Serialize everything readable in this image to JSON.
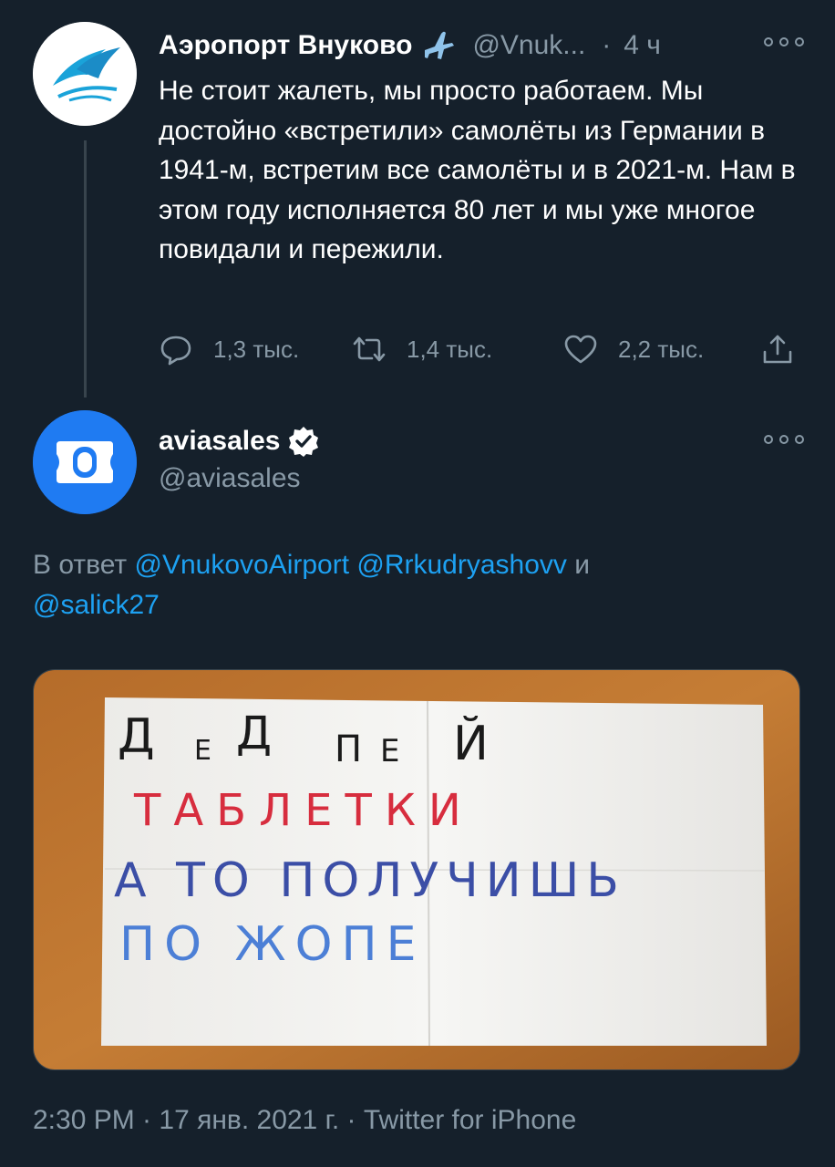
{
  "tweet1": {
    "display_name": "Аэропорт Внуково",
    "name_emoji_icon": "airplane-icon",
    "handle": "@Vnuk...",
    "separator": "·",
    "time": "4 ч",
    "text": "Не стоит жалеть, мы просто работаем. Мы достойно «встретили» самолёты из Германии в 1941-м, встретим все самолёты и в 2021-м. Нам в этом году исполняется 80 лет и мы уже многое повидали и пережили.",
    "actions": {
      "reply_count": "1,3 тыс.",
      "retweet_count": "1,4 тыс.",
      "like_count": "2,2 тыс."
    }
  },
  "tweet2": {
    "display_name": "aviasales",
    "handle": "@aviasales",
    "reply_prefix": "В ответ",
    "mention1": "@VnukovoAirport",
    "mention2": "@Rrkudryashovv",
    "conjunction": "и",
    "mention3": "@salick27",
    "photo_text": {
      "line1": [
        "Д",
        "Е",
        "Д",
        "П",
        "Е",
        "Й"
      ],
      "line2": "ТАБЛЕТКИ",
      "line3": "А ТО ПОЛУЧИШЬ",
      "line4": "ПО ЖОПЕ"
    },
    "footer": "2:30 PM · 17 янв. 2021 г. · Twitter for iPhone"
  },
  "colors": {
    "background": "#15202b",
    "text_primary": "#ffffff",
    "text_secondary": "#8899a6",
    "accent": "#1da1f2",
    "aviasales_blue": "#1f7bf2",
    "vnukovo_blue": "#1aa3d9"
  }
}
